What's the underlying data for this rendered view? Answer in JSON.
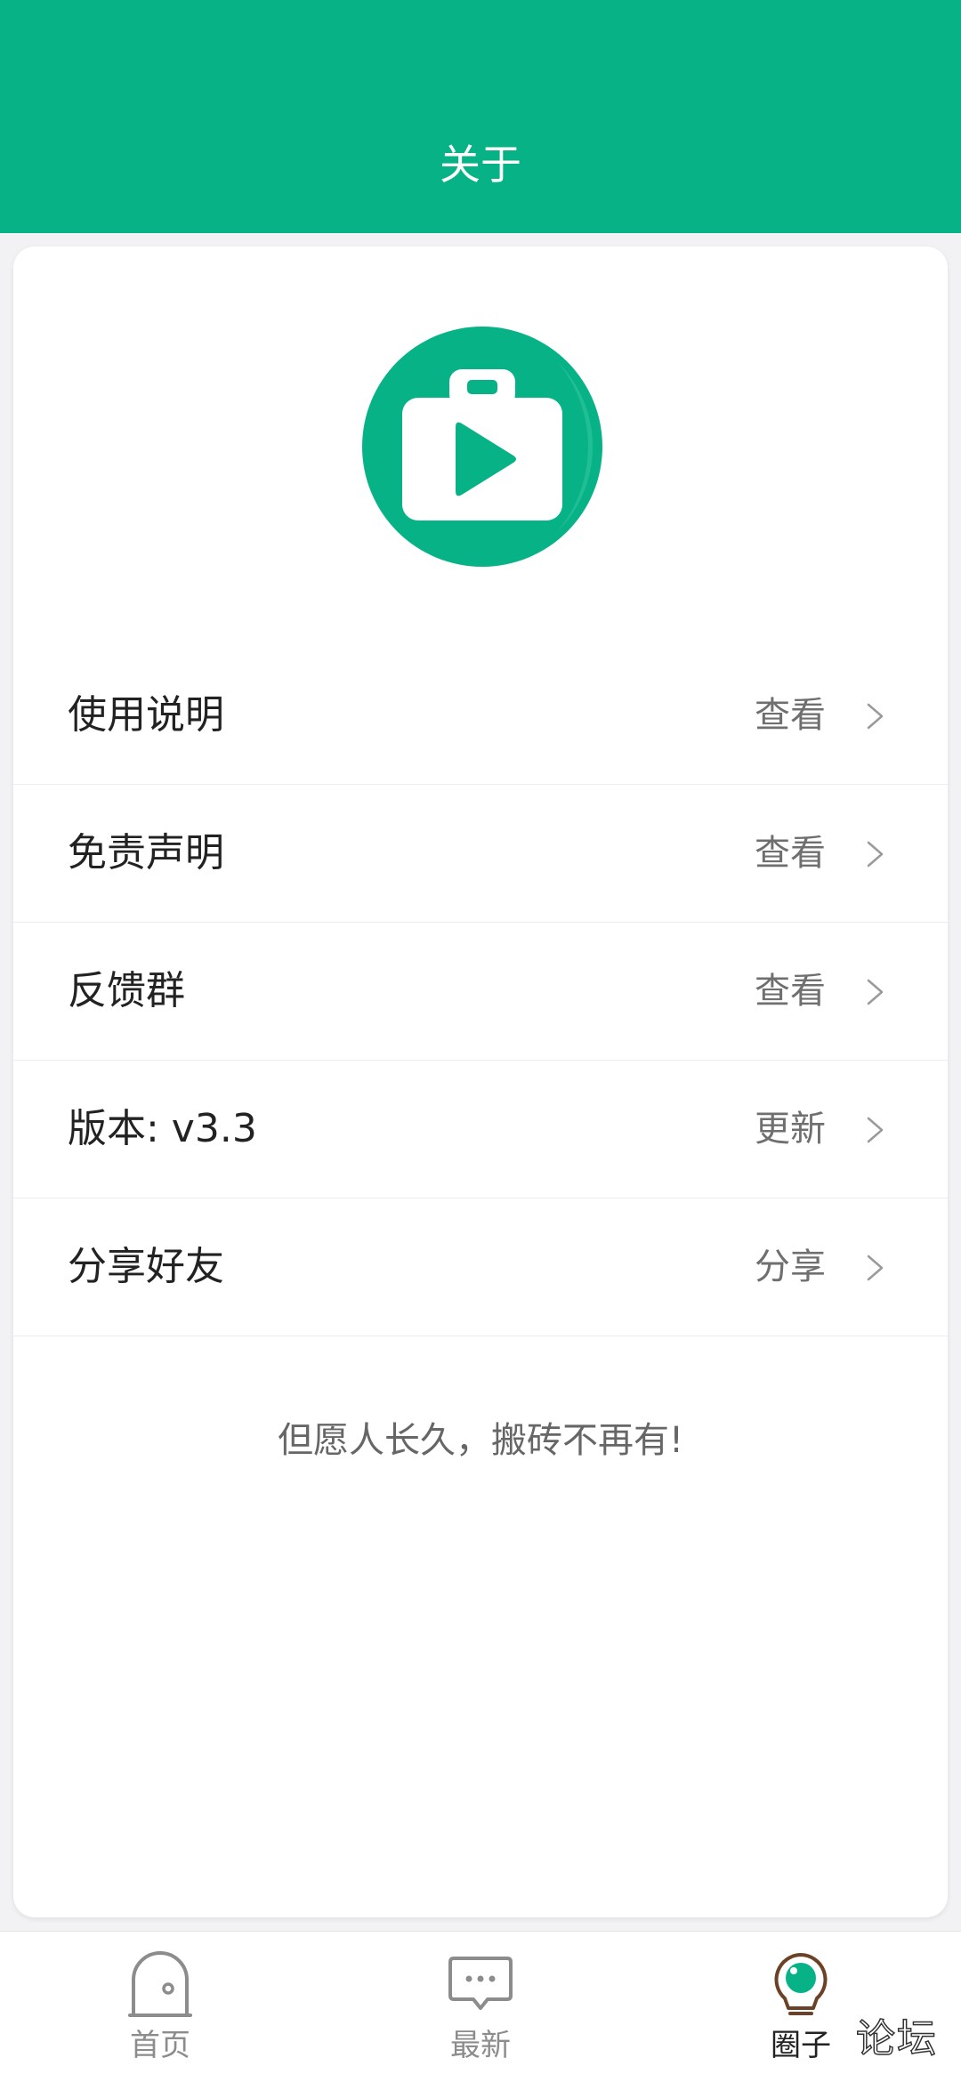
{
  "header": {
    "title": "关于",
    "background_color": "#07b386"
  },
  "logo": {
    "icon": "video-briefcase-icon",
    "color": "#07b386"
  },
  "menu": {
    "items": [
      {
        "label": "使用说明",
        "action": "查看"
      },
      {
        "label": "免责声明",
        "action": "查看"
      },
      {
        "label": "反馈群",
        "action": "查看"
      },
      {
        "label": "版本: v3.3",
        "action": "更新"
      },
      {
        "label": "分享好友",
        "action": "分享"
      }
    ]
  },
  "slogan": "但愿人长久，搬砖不再有!",
  "tabbar": {
    "tabs": [
      {
        "label": "首页",
        "icon": "home-icon",
        "active": false
      },
      {
        "label": "最新",
        "icon": "chat-bubble-icon",
        "active": false
      },
      {
        "label": "圈子",
        "icon": "lightbulb-icon",
        "active": true
      }
    ]
  },
  "watermark": "论坛"
}
